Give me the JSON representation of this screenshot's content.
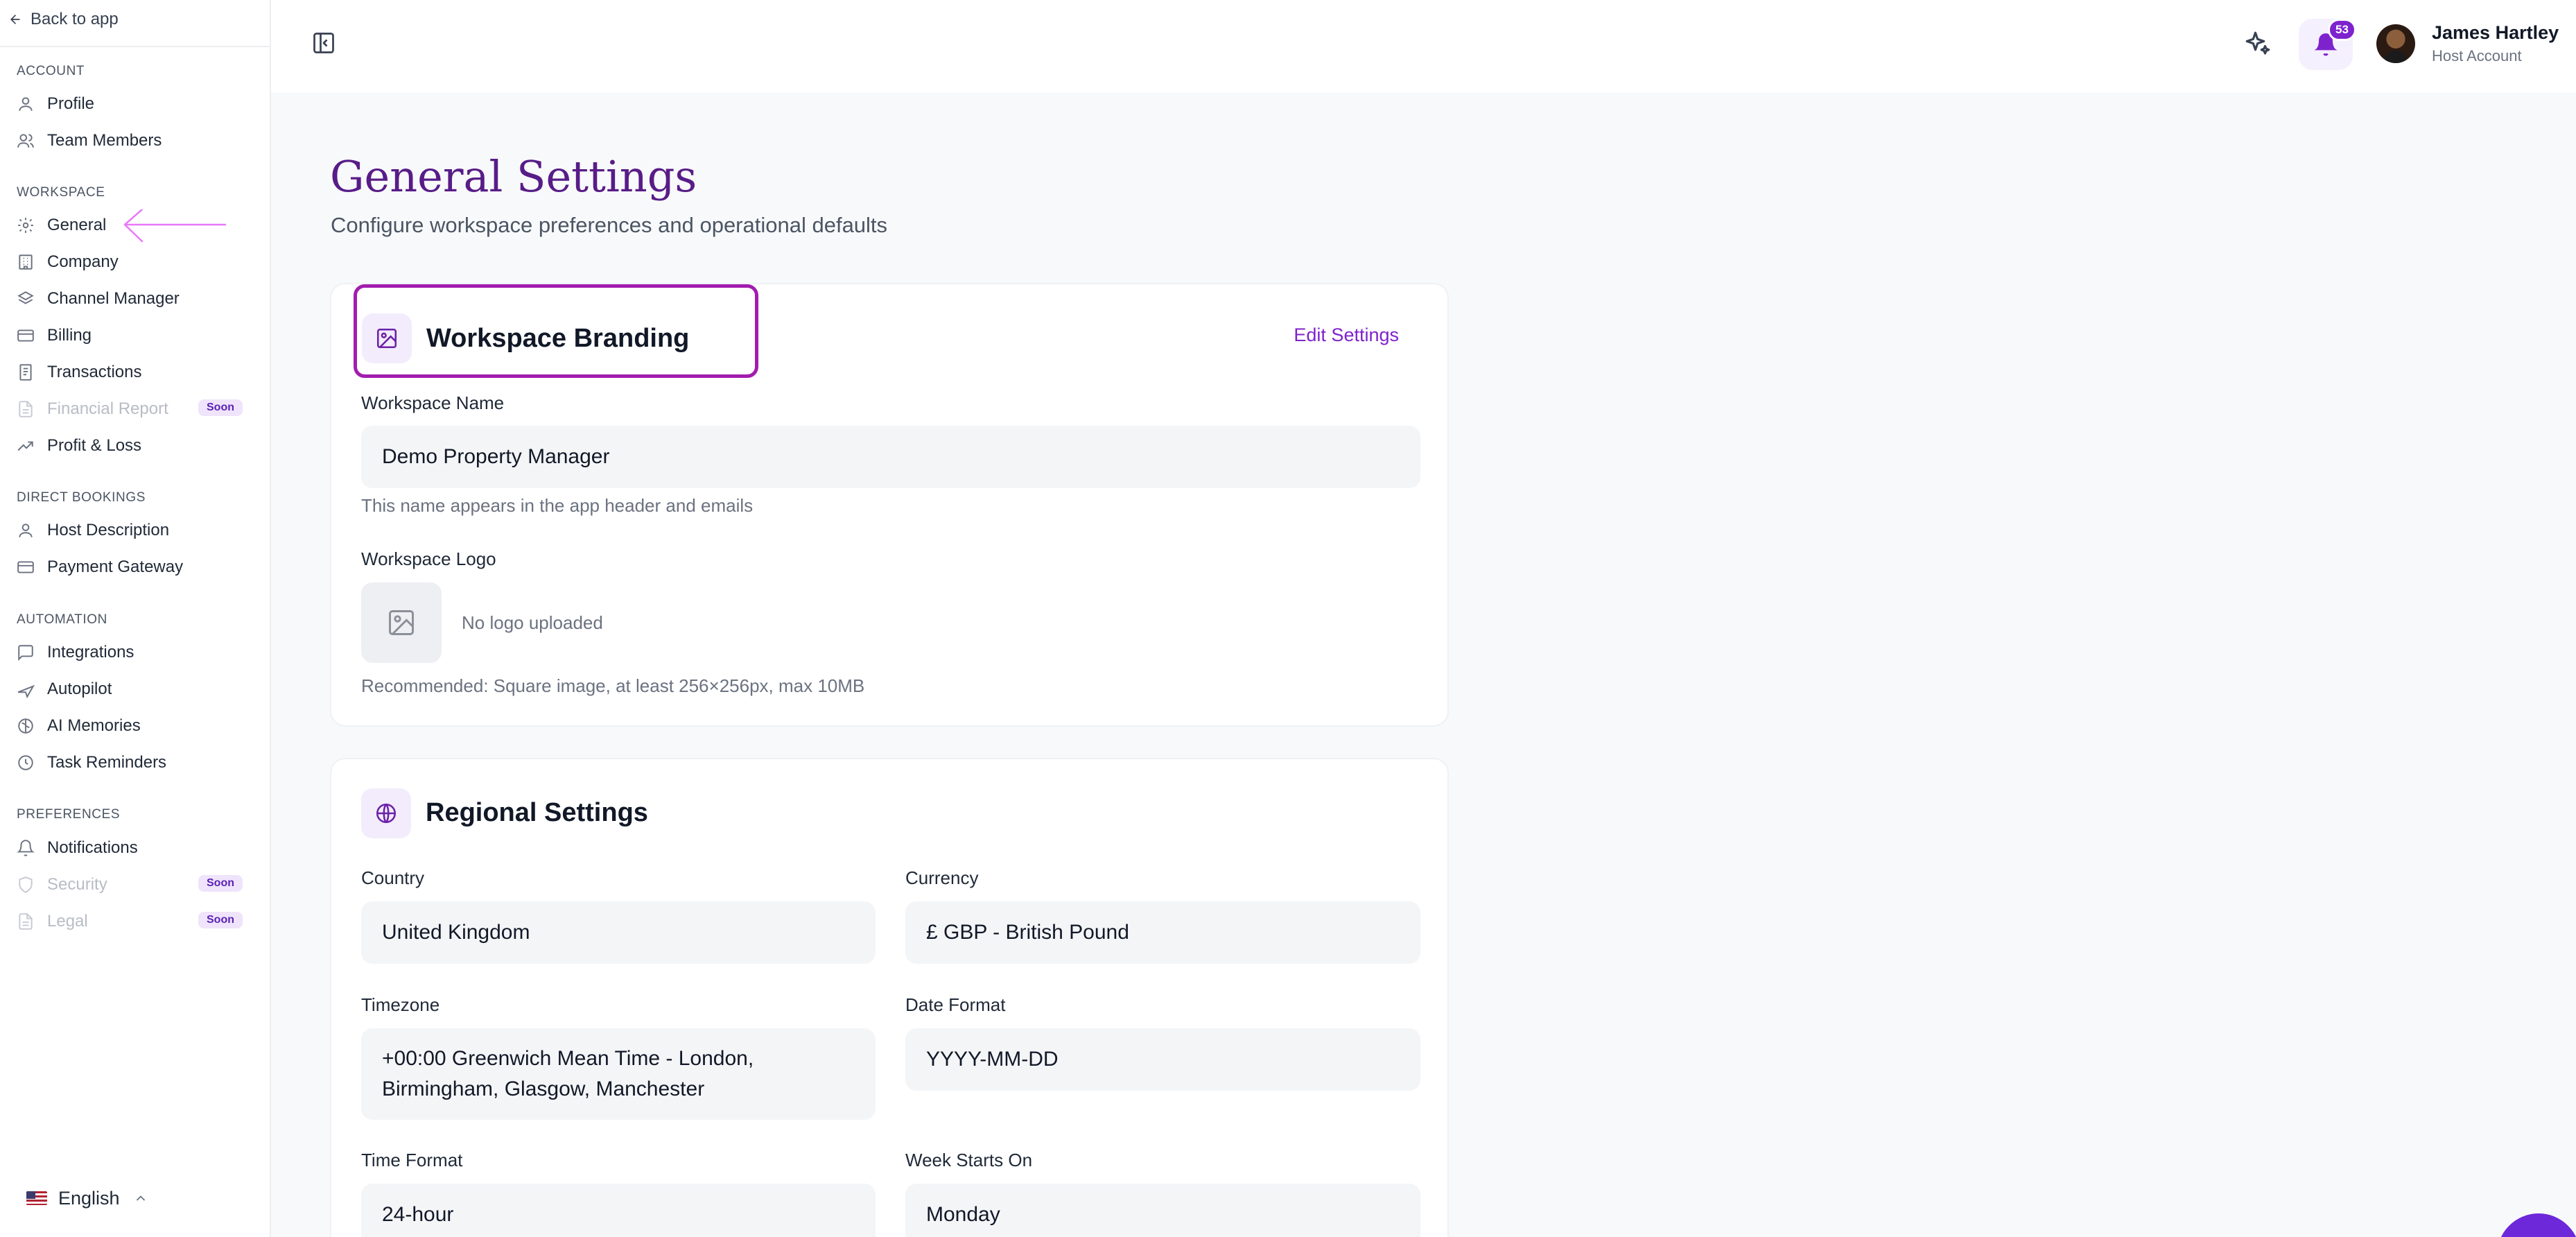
{
  "sidebar": {
    "back_label": "Back to app",
    "sections": [
      {
        "title": "ACCOUNT",
        "items": [
          {
            "label": "Profile",
            "icon": "user-icon"
          },
          {
            "label": "Team Members",
            "icon": "users-icon"
          }
        ]
      },
      {
        "title": "WORKSPACE",
        "items": [
          {
            "label": "General",
            "icon": "gear-icon"
          },
          {
            "label": "Company",
            "icon": "building-icon"
          },
          {
            "label": "Channel Manager",
            "icon": "layers-icon"
          },
          {
            "label": "Billing",
            "icon": "credit-card-icon"
          },
          {
            "label": "Transactions",
            "icon": "receipt-icon"
          },
          {
            "label": "Financial Report",
            "icon": "file-icon",
            "badge": "Soon"
          },
          {
            "label": "Profit & Loss",
            "icon": "trending-up-icon"
          }
        ]
      },
      {
        "title": "DIRECT BOOKINGS",
        "items": [
          {
            "label": "Host Description",
            "icon": "user-icon"
          },
          {
            "label": "Payment Gateway",
            "icon": "credit-card-icon"
          }
        ]
      },
      {
        "title": "AUTOMATION",
        "items": [
          {
            "label": "Integrations",
            "icon": "message-square-icon"
          },
          {
            "label": "Autopilot",
            "icon": "plane-icon"
          },
          {
            "label": "AI Memories",
            "icon": "brain-icon"
          },
          {
            "label": "Task Reminders",
            "icon": "clock-icon"
          }
        ]
      },
      {
        "title": "PREFERENCES",
        "items": [
          {
            "label": "Notifications",
            "icon": "bell-icon"
          },
          {
            "label": "Security",
            "icon": "shield-icon",
            "badge": "Soon"
          },
          {
            "label": "Legal",
            "icon": "file-icon",
            "badge": "Soon"
          }
        ]
      }
    ],
    "language": "English"
  },
  "topbar": {
    "notification_count": "53",
    "user_name": "James Hartley",
    "user_role": "Host Account"
  },
  "page": {
    "title": "General Settings",
    "subtitle": "Configure workspace preferences and operational defaults"
  },
  "branding": {
    "title": "Workspace Branding",
    "edit_label": "Edit Settings",
    "name_label": "Workspace Name",
    "name_value": "Demo Property Manager",
    "name_help": "This name appears in the app header and emails",
    "logo_label": "Workspace Logo",
    "logo_status": "No logo uploaded",
    "logo_help": "Recommended: Square image, at least 256×256px, max 10MB"
  },
  "regional": {
    "title": "Regional Settings",
    "country_label": "Country",
    "country_value": "United Kingdom",
    "currency_label": "Currency",
    "currency_value": "£ GBP - British Pound",
    "timezone_label": "Timezone",
    "timezone_value": "+00:00 Greenwich Mean Time - London, Birmingham, Glasgow, Manchester",
    "date_format_label": "Date Format",
    "date_format_value": "YYYY-MM-DD",
    "time_format_label": "Time Format",
    "time_format_value": "24-hour",
    "week_start_label": "Week Starts On",
    "week_start_value": "Monday"
  },
  "colors": {
    "accent": "#7e22ce",
    "title": "#581c87",
    "highlight": "#a21caf"
  }
}
